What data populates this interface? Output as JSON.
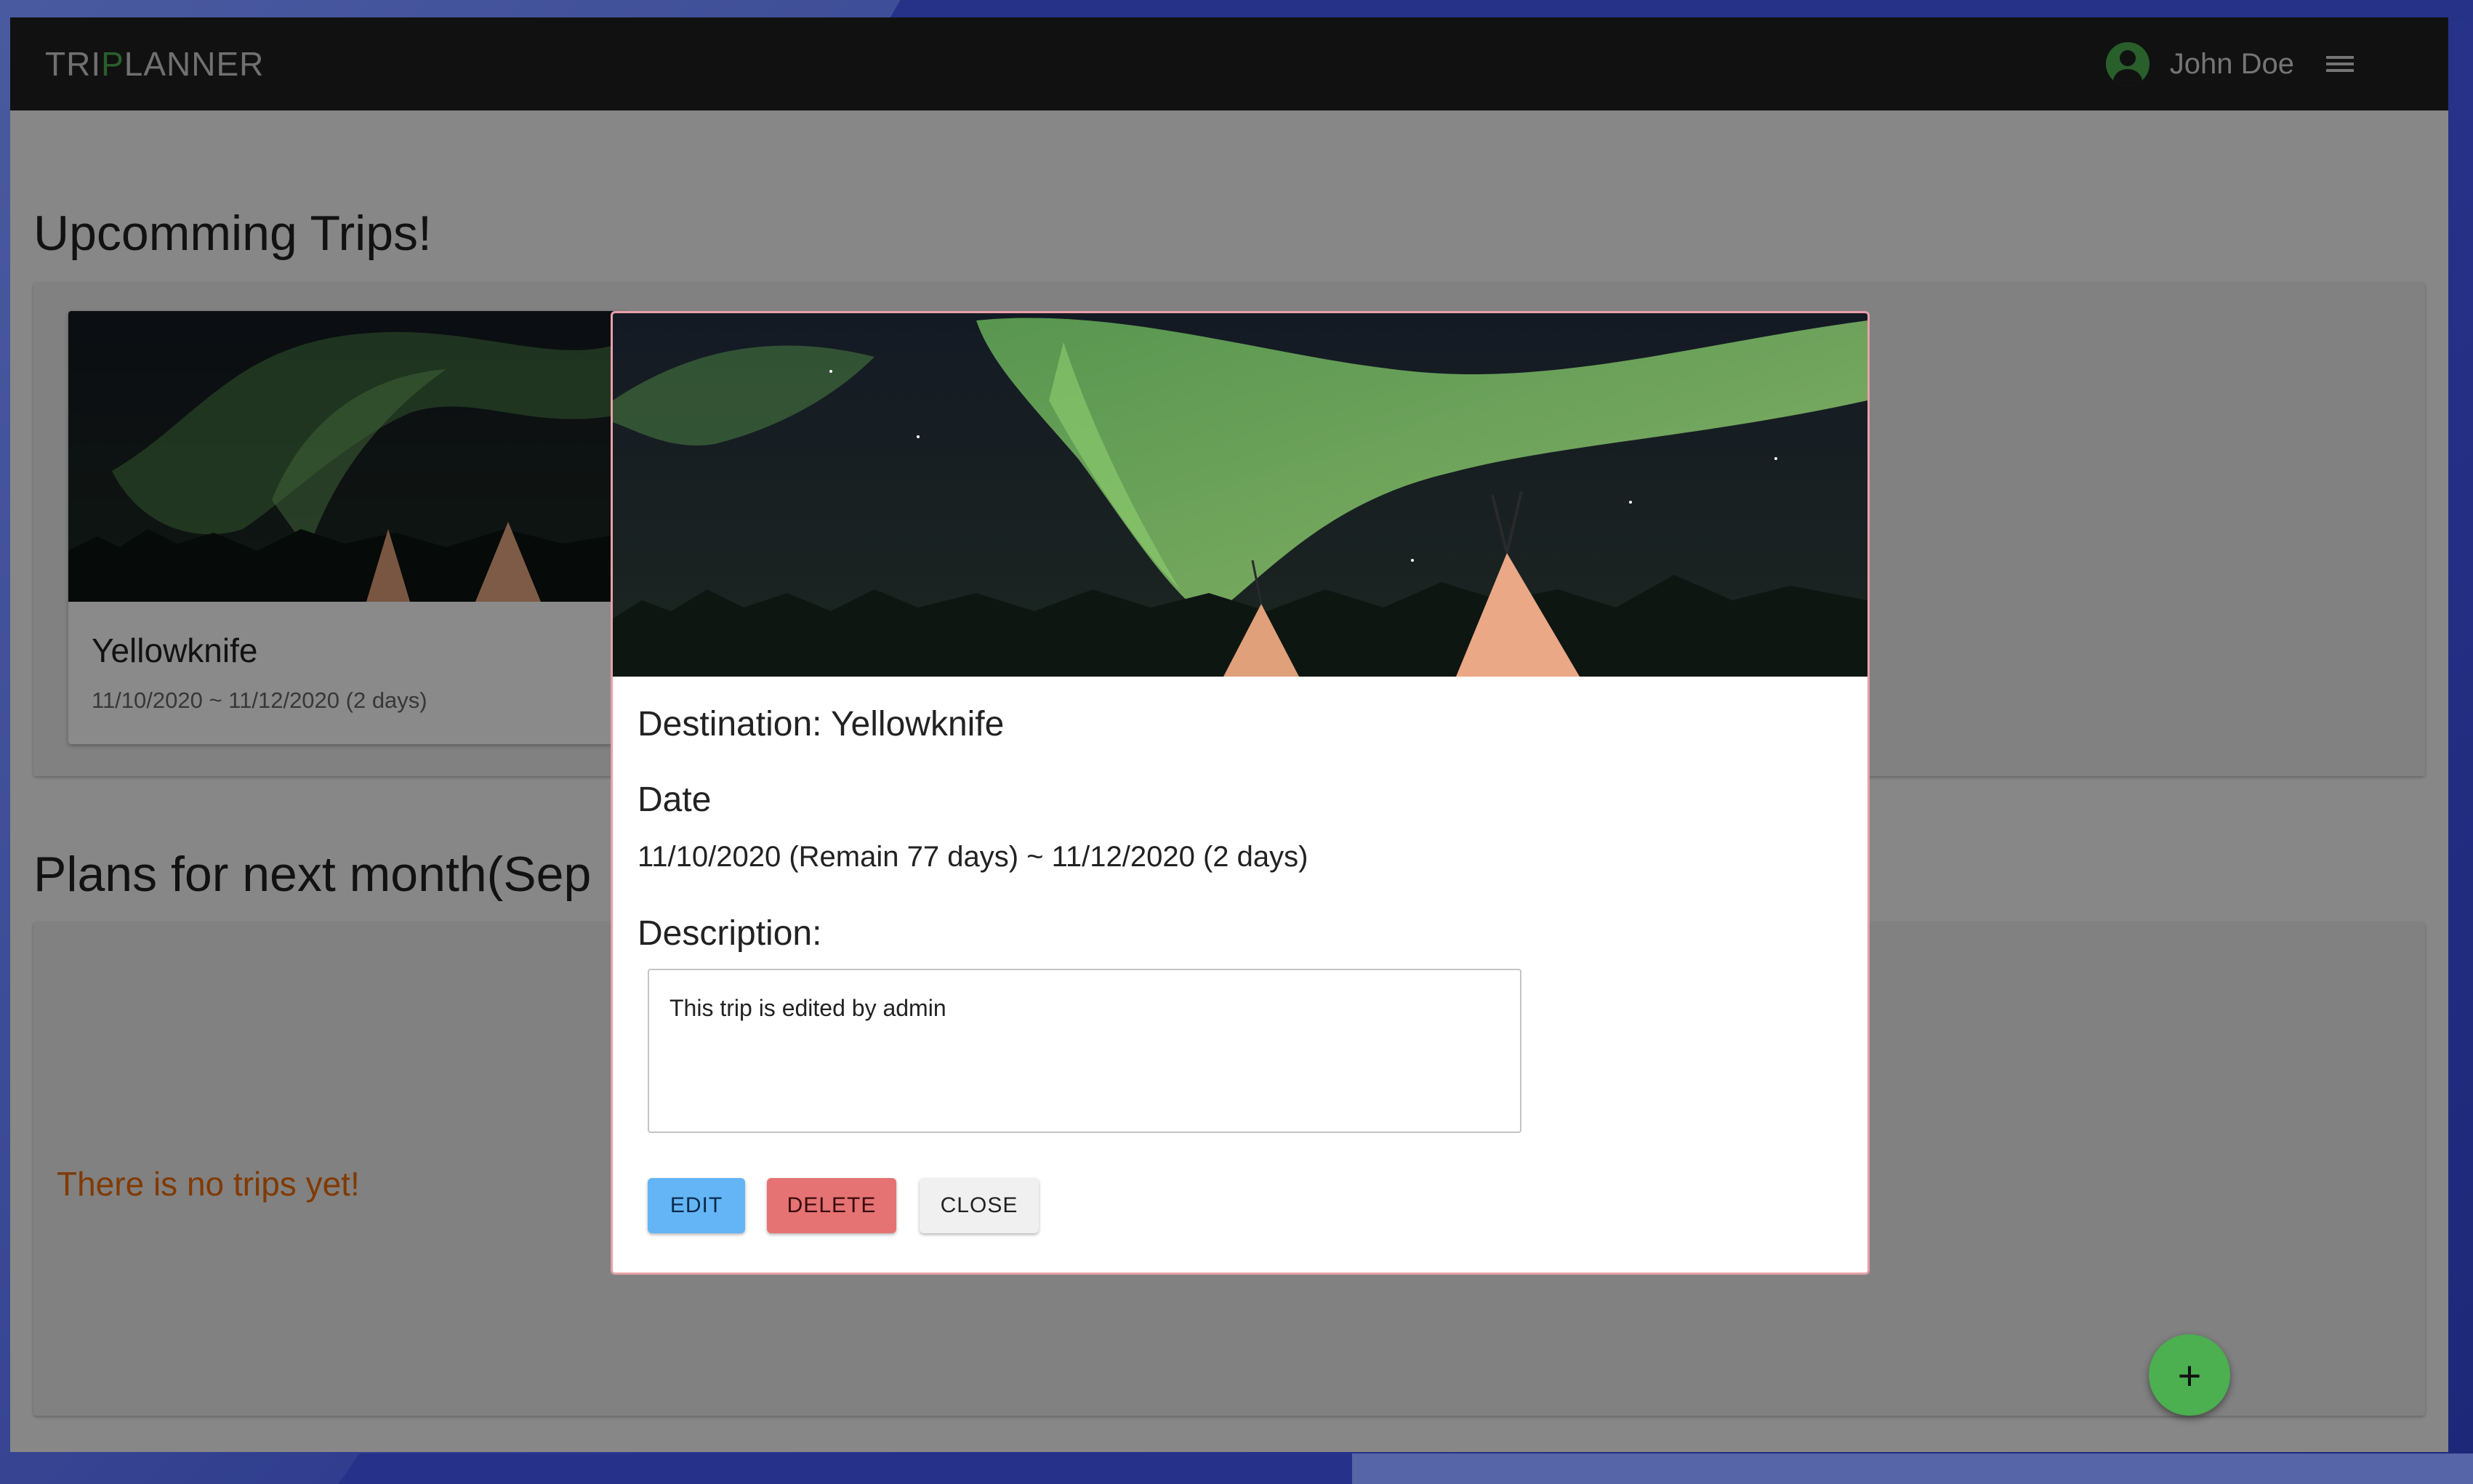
{
  "app": {
    "logo_prefix": "TRI",
    "logo_accent": "P",
    "logo_suffix": "LANNER",
    "user_name": "John Doe",
    "accent_color": "#4caf50"
  },
  "sections": {
    "upcoming_title": "Upcomming Trips!",
    "next_month_title": "Plans for next month(Sep",
    "empty_message": "There is no trips yet!"
  },
  "trip_card": {
    "name": "Yellowknife",
    "dates": "11/10/2020 ~ 11/12/2020 (2 days)",
    "image": "aurora-teepee-night"
  },
  "modal": {
    "destination": "Destination: Yellowknife",
    "date_label": "Date",
    "date_value": "11/10/2020 (Remain 77 days) ~ 11/12/2020 (2 days)",
    "description_label": "Description:",
    "description_value": "This trip is edited by admin",
    "buttons": {
      "edit": "EDIT",
      "delete": "DELETE",
      "close": "CLOSE"
    }
  },
  "fab": {
    "label": "+"
  }
}
